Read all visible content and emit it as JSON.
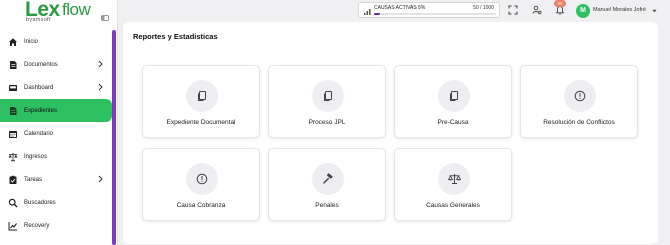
{
  "brand": {
    "name_bold": "Lex",
    "name_light": "flow",
    "sub": "byamsoft"
  },
  "sidebar": {
    "items": [
      {
        "label": "Inicio",
        "icon": "home-icon",
        "has_children": false,
        "active": false
      },
      {
        "label": "Documentos",
        "icon": "document-icon",
        "has_children": true,
        "active": false
      },
      {
        "label": "Dashboard",
        "icon": "dashboard-icon",
        "has_children": true,
        "active": false
      },
      {
        "label": "Expedientes",
        "icon": "folder-file-icon",
        "has_children": false,
        "active": true
      },
      {
        "label": "Calendario",
        "icon": "calendar-icon",
        "has_children": false,
        "active": false
      },
      {
        "label": "Ingresos",
        "icon": "balance-scale-icon",
        "has_children": false,
        "active": false
      },
      {
        "label": "Tareas",
        "icon": "tasks-icon",
        "has_children": true,
        "active": false
      },
      {
        "label": "Buscadores",
        "icon": "search-icon",
        "has_children": false,
        "active": false
      },
      {
        "label": "Recovery",
        "icon": "chart-line-icon",
        "has_children": false,
        "active": false
      }
    ],
    "active_color": "#2fbf63"
  },
  "header": {
    "causas": {
      "label": "CAUSAS ACTIVAS 5%",
      "count": "50 / 1000",
      "percent": 5,
      "bar_color": "#6a2ba0"
    },
    "notifications_count": "99",
    "user": {
      "initial": "M",
      "name": "Manuel Morales Jofré"
    }
  },
  "main": {
    "title": "Reportes y Estadisticas",
    "cards": [
      {
        "label": "Expediente Documental",
        "icon": "copy-icon"
      },
      {
        "label": "Proceso JPL",
        "icon": "copy-icon"
      },
      {
        "label": "Pre-Causa",
        "icon": "copy-icon"
      },
      {
        "label": "Resolución de Conflictos",
        "icon": "alert-circle-icon"
      },
      {
        "label": "Causa Cobranza",
        "icon": "alert-circle-icon"
      },
      {
        "label": "Penales",
        "icon": "gavel-icon"
      },
      {
        "label": "Causas Generales",
        "icon": "balance-scale-icon"
      }
    ]
  }
}
